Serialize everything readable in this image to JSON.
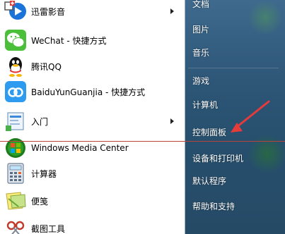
{
  "start_menu": {
    "programs": [
      {
        "label": "迅雷影音",
        "icon": "xunlei-player-icon",
        "has_submenu": true
      },
      {
        "label": "WeChat - 快捷方式",
        "icon": "wechat-icon",
        "has_submenu": false
      },
      {
        "label": "腾讯QQ",
        "icon": "qq-icon",
        "has_submenu": false
      },
      {
        "label": "BaiduYunGuanjia - 快捷方式",
        "icon": "baidu-cloud-icon",
        "has_submenu": false
      },
      {
        "label": "入门",
        "icon": "getting-started-icon",
        "has_submenu": true
      },
      {
        "label": "Windows Media Center",
        "icon": "windows-media-center-icon",
        "has_submenu": false
      },
      {
        "label": "计算器",
        "icon": "calculator-icon",
        "has_submenu": false
      },
      {
        "label": "便笺",
        "icon": "sticky-notes-icon",
        "has_submenu": false
      },
      {
        "label": "截图工具",
        "icon": "snipping-tool-icon",
        "has_submenu": false
      }
    ],
    "right_items": [
      {
        "label": "文档"
      },
      {
        "label": "图片"
      },
      {
        "label": "音乐"
      },
      {
        "label": "游戏"
      },
      {
        "label": "计算机"
      },
      {
        "label": "控制面板"
      },
      {
        "label": "设备和打印机"
      },
      {
        "label": "默认程序"
      },
      {
        "label": "帮助和支持"
      }
    ]
  },
  "colors": {
    "annotation_red": "#e53b3b",
    "right_panel": "#2d5677"
  }
}
